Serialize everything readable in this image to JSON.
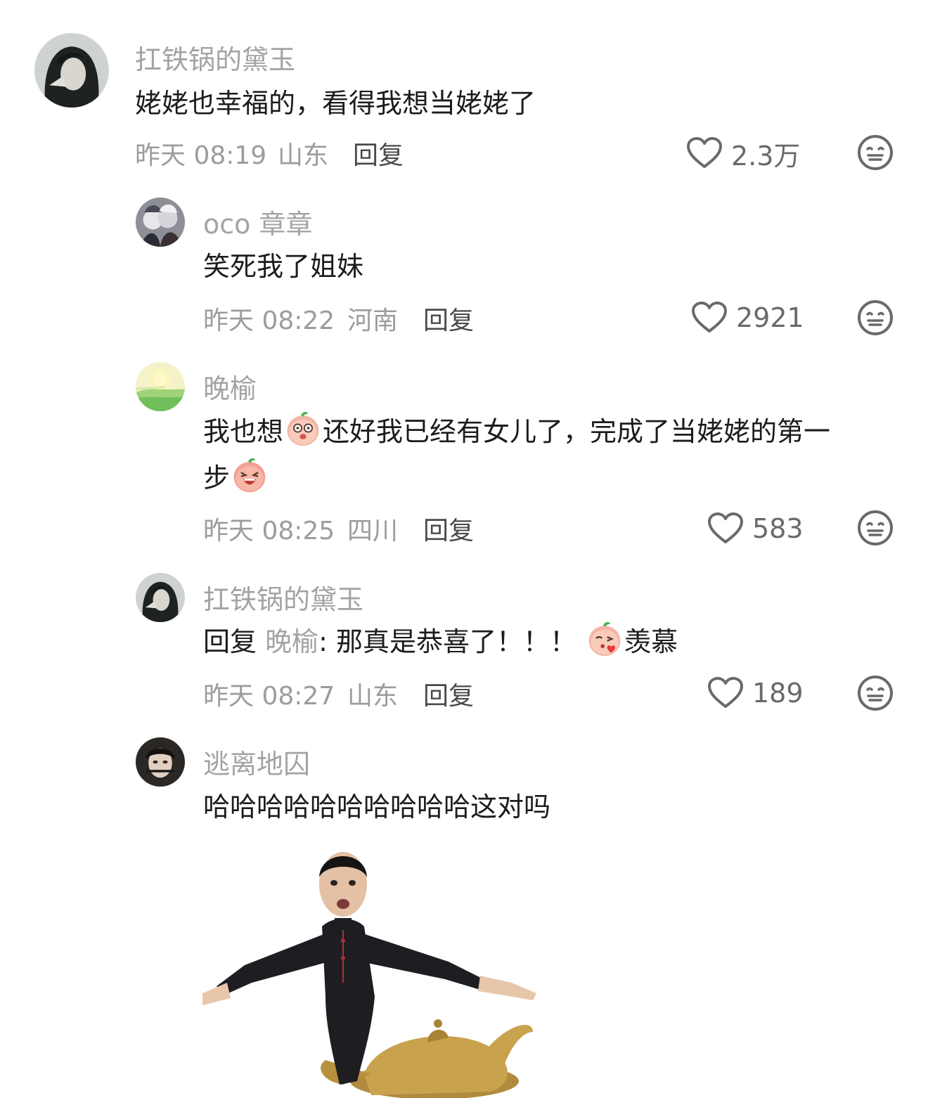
{
  "comments": [
    {
      "username": "扛铁锅的黛玉",
      "text": "姥姥也幸福的，看得我想当姥姥了",
      "time": "昨天 08:19",
      "location": "山东",
      "reply_label": "回复",
      "likes": "2.3万",
      "avatar": "dark-haired-woman-avatar"
    },
    {
      "username": "oco 章章",
      "text": "笑死我了姐妹",
      "time": "昨天 08:22",
      "location": "河南",
      "reply_label": "回复",
      "likes": "2921",
      "avatar": "anime-pair-avatar"
    },
    {
      "username": "晚榆",
      "text_part1": "我也想",
      "text_part2": "还好我已经有女儿了，完成了当姥姥的第一",
      "text_line2": "步",
      "time": "昨天 08:25",
      "location": "四川",
      "reply_label": "回复",
      "likes": "583",
      "avatar": "sunny-meadow-avatar"
    },
    {
      "username": "扛铁锅的黛玉",
      "reply_prefix": "回复",
      "reply_target": "晚榆",
      "text": ": 那真是恭喜了！！！",
      "emoji_text": "羡慕",
      "time": "昨天 08:27",
      "location": "山东",
      "reply_label": "回复",
      "likes": "189",
      "avatar": "dark-haired-woman-avatar"
    },
    {
      "username": "逃离地囚",
      "text": "哈哈哈哈哈哈哈哈哈哈这对吗",
      "avatar": "girl-portrait-avatar",
      "sticker": "genie-lamp-meme-sticker"
    }
  ],
  "colors": {
    "username": "#a3a3a3",
    "text": "#1c1c1c",
    "meta": "#9c9c9c",
    "icon": "#6a6a6a"
  },
  "icons": {
    "like": "heart-outline-icon",
    "dislike": "meh-face-icon"
  }
}
